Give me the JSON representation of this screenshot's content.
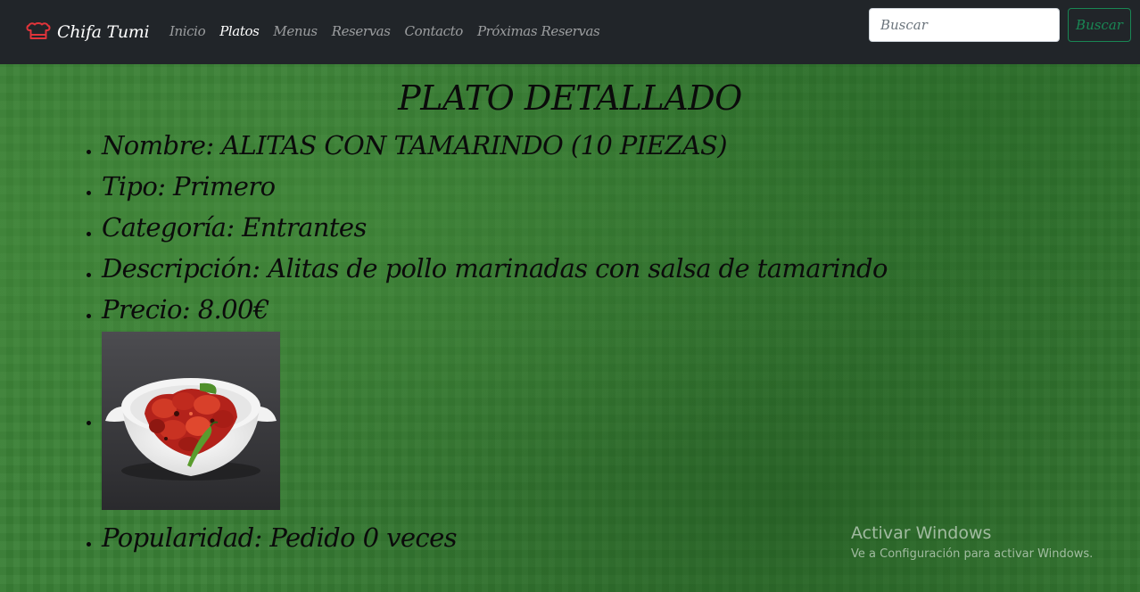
{
  "navbar": {
    "brand": "Chifa Tumi",
    "links": [
      {
        "label": "Inicio",
        "active": false
      },
      {
        "label": "Platos",
        "active": true
      },
      {
        "label": "Menus",
        "active": false
      },
      {
        "label": "Reservas",
        "active": false
      },
      {
        "label": "Contacto",
        "active": false
      },
      {
        "label": "Próximas Reservas",
        "active": false
      }
    ],
    "search": {
      "placeholder": "Buscar",
      "value": "",
      "button_label": "Buscar"
    }
  },
  "main": {
    "title": "PLATO DETALLADO",
    "details": [
      {
        "label": "Nombre:",
        "value": "ALITAS CON TAMARINDO (10 PIEZAS)"
      },
      {
        "label": "Tipo:",
        "value": "Primero"
      },
      {
        "label": "Categoría:",
        "value": "Entrantes"
      },
      {
        "label": "Descripción:",
        "value": "Alitas de pollo marinadas con salsa de tamarindo"
      },
      {
        "label": "Precio:",
        "value": "8.00€"
      }
    ],
    "popularity": {
      "label": "Popularidad:",
      "value": "Pedido 0 veces"
    }
  },
  "watermark": {
    "title": "Activar Windows",
    "subtitle": "Ve a Configuración para activar Windows."
  },
  "colors": {
    "navbar_bg": "#212529",
    "background_green": "#3a8036",
    "success_green": "#198754",
    "brand_icon_red": "#e0343a"
  }
}
